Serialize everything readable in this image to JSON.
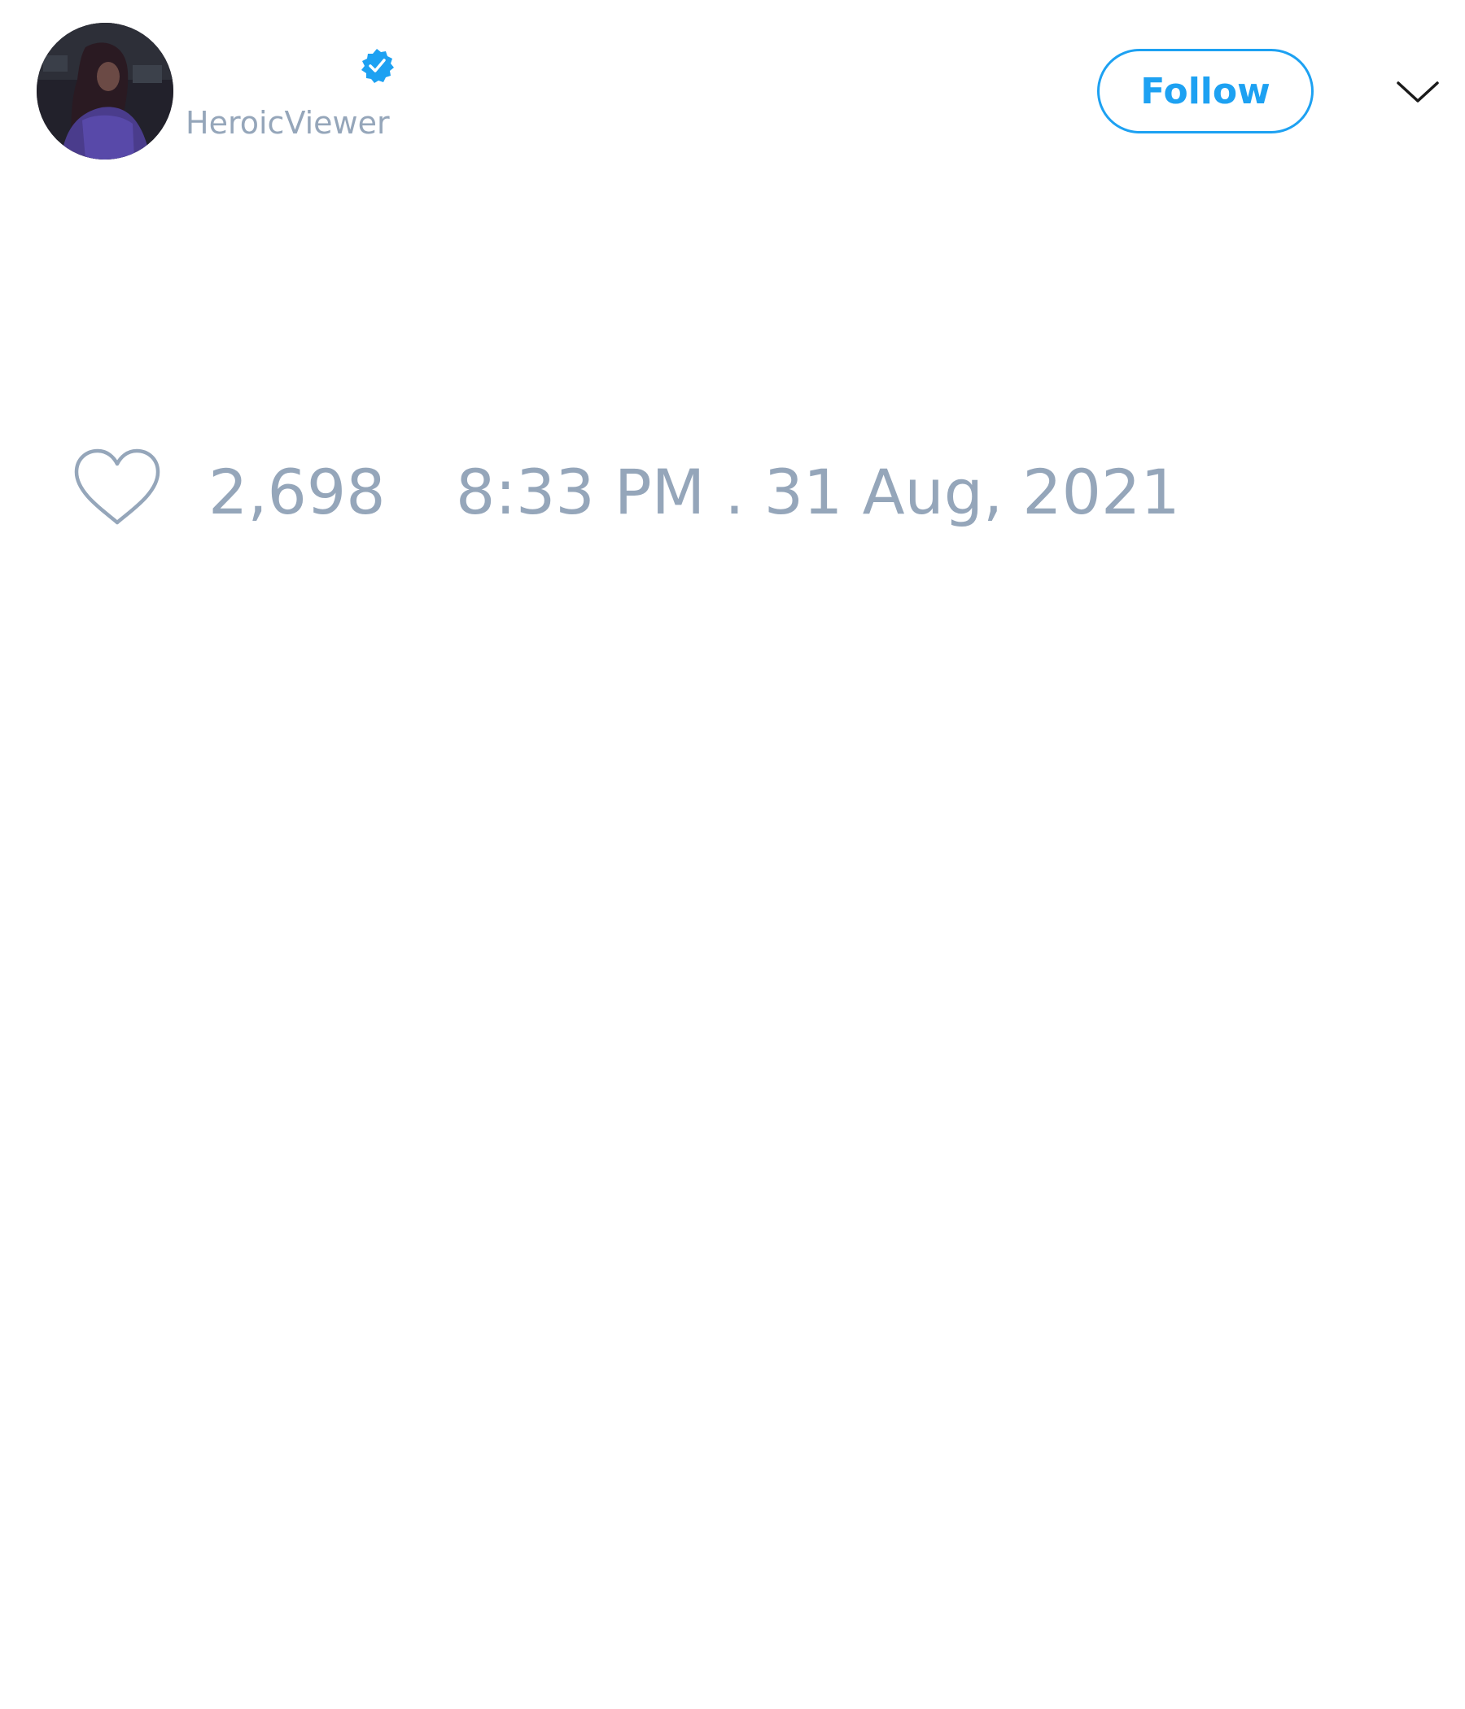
{
  "author": {
    "handle": "HeroicViewer",
    "verified": true,
    "avatar_icon": "profile-photo"
  },
  "actions": {
    "follow_label": "Follow",
    "menu_icon": "chevron-down-icon"
  },
  "footer": {
    "like_icon": "heart-outline-icon",
    "like_count": "2,698",
    "timestamp": "8:33 PM . 31 Aug, 2021"
  },
  "colors": {
    "accent": "#1da1f2",
    "muted_text": "#95a6ba",
    "background": "#ffffff"
  }
}
